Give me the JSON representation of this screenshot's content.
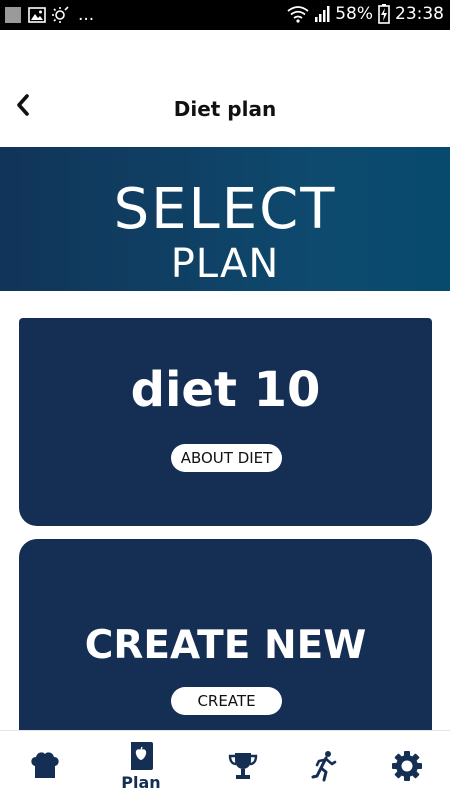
{
  "status_bar": {
    "left_more": "...",
    "battery_percent": "58%",
    "time": "23:38"
  },
  "header": {
    "title": "Diet plan"
  },
  "banner": {
    "line1": "SELECT",
    "line2": "PLAN"
  },
  "cards": {
    "diet": {
      "title": "diet 10",
      "button_label": "ABOUT DIET"
    },
    "create": {
      "title": "CREATE NEW",
      "button_label": "CREATE"
    }
  },
  "bottom_nav": {
    "items": [
      {
        "icon": "chef-hat-icon",
        "label": ""
      },
      {
        "icon": "plan-book-icon",
        "label": "Plan",
        "active": true
      },
      {
        "icon": "trophy-icon",
        "label": ""
      },
      {
        "icon": "running-icon",
        "label": ""
      },
      {
        "icon": "gear-icon",
        "label": ""
      }
    ]
  },
  "colors": {
    "primary": "#142f53",
    "banner_start": "#113459",
    "banner_end": "#074a6e",
    "background": "#ffffff"
  }
}
